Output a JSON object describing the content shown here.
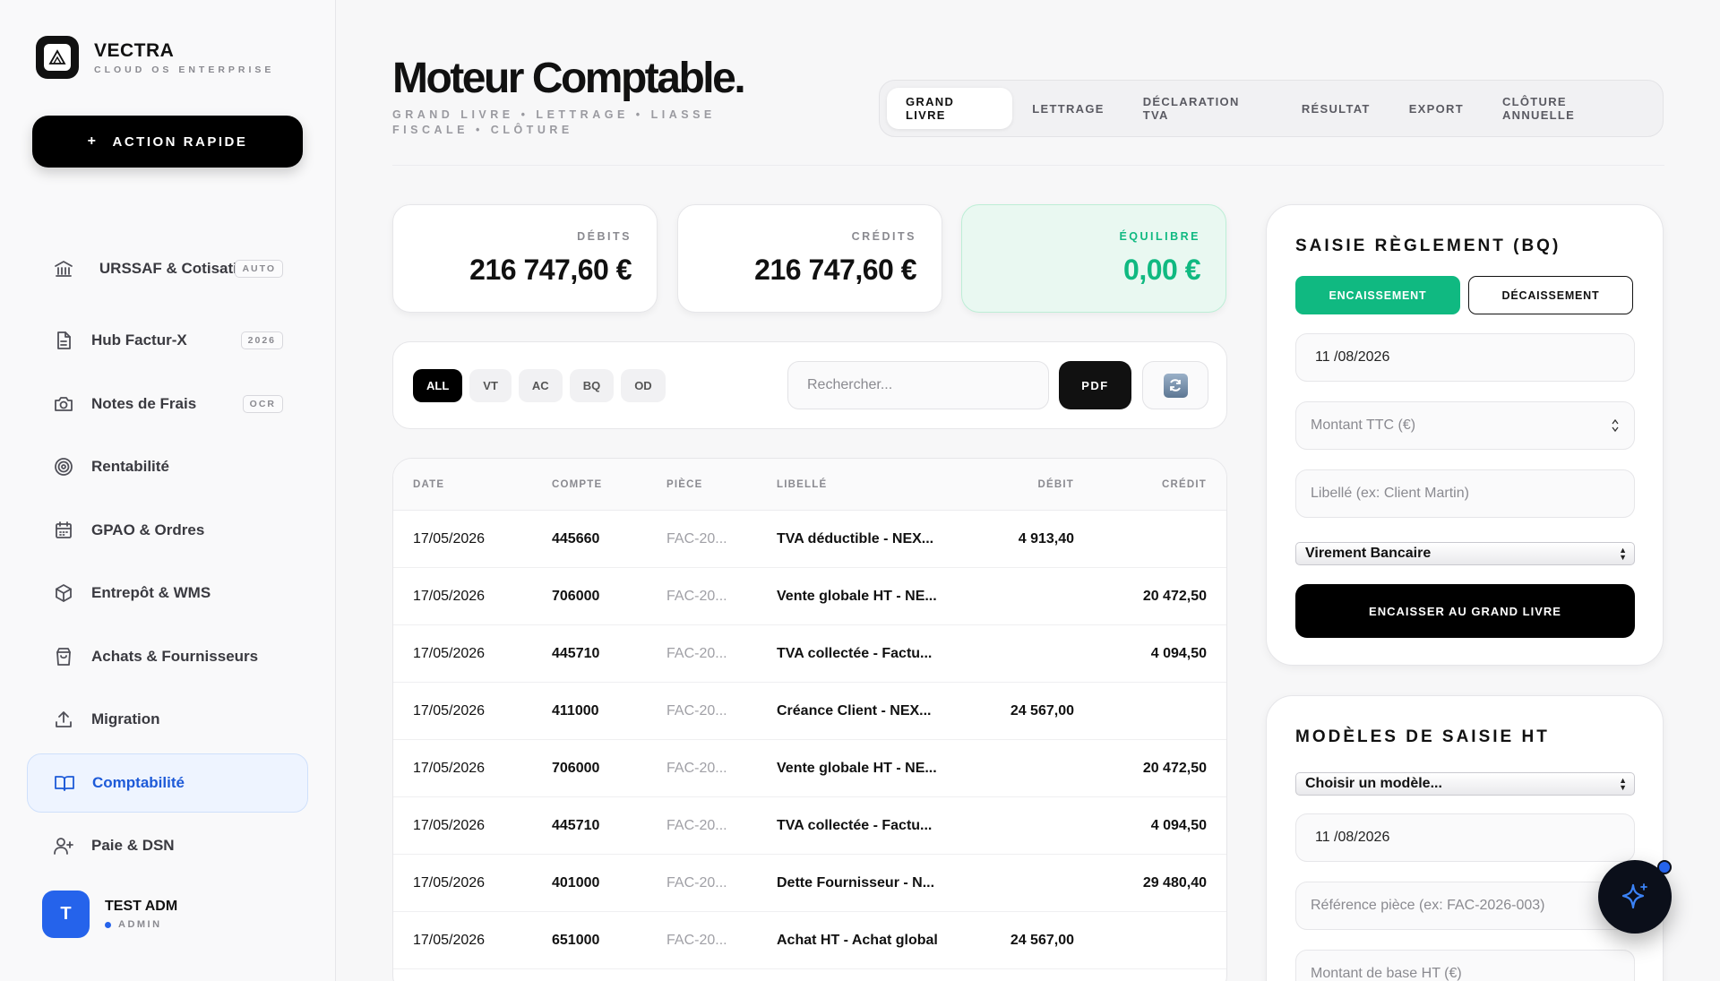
{
  "brand": {
    "name": "VECTRA",
    "subtitle": "CLOUD OS ENTERPRISE"
  },
  "quick_action": {
    "plus": "+",
    "label": "ACTION RAPIDE"
  },
  "sidebar": {
    "items": [
      {
        "label": "URSSAF & Cotisations",
        "icon": "bank-icon",
        "badge": "AUTO"
      },
      {
        "label": "Hub Factur-X",
        "icon": "document-icon",
        "badge": "2026"
      },
      {
        "label": "Notes de Frais",
        "icon": "camera-icon",
        "badge": "OCR"
      },
      {
        "label": "Rentabilité",
        "icon": "target-icon",
        "badge": ""
      },
      {
        "label": "GPAO & Ordres",
        "icon": "calendar-icon",
        "badge": ""
      },
      {
        "label": "Entrepôt & WMS",
        "icon": "box-icon",
        "badge": ""
      },
      {
        "label": "Achats & Fournisseurs",
        "icon": "shopping-bag-icon",
        "badge": ""
      },
      {
        "label": "Migration",
        "icon": "upload-icon",
        "badge": ""
      },
      {
        "label": "Comptabilité",
        "icon": "book-icon",
        "badge": "",
        "active": true
      },
      {
        "label": "Paie & DSN",
        "icon": "user-plus-icon",
        "badge": ""
      }
    ]
  },
  "user": {
    "initial": "T",
    "name": "TEST ADM",
    "role": "ADMIN"
  },
  "header": {
    "title": "Moteur Comptable.",
    "subtitle": "GRAND LIVRE • LETTRAGE • LIASSE FISCALE • CLÔTURE",
    "tabs": [
      "GRAND LIVRE",
      "LETTRAGE",
      "DÉCLARATION TVA",
      "RÉSULTAT",
      "EXPORT",
      "CLÔTURE ANNUELLE"
    ]
  },
  "stats": {
    "debits": {
      "label": "DÉBITS",
      "value": "216 747,60 €"
    },
    "credits": {
      "label": "CRÉDITS",
      "value": "216 747,60 €"
    },
    "balance": {
      "label": "ÉQUILIBRE",
      "value": "0,00 €"
    }
  },
  "filters": {
    "chips": [
      "ALL",
      "VT",
      "AC",
      "BQ",
      "OD"
    ],
    "search_placeholder": "Rechercher...",
    "pdf_label": "PDF"
  },
  "ledger": {
    "headers": {
      "date": "DATE",
      "account": "COMPTE",
      "piece": "PIÈCE",
      "label": "LIBELLÉ",
      "debit": "DÉBIT",
      "credit": "CRÉDIT"
    },
    "rows": [
      {
        "date": "17/05/2026",
        "account": "445660",
        "piece": "FAC-20...",
        "label": "TVA déductible - NEX...",
        "debit": "4 913,40",
        "credit": ""
      },
      {
        "date": "17/05/2026",
        "account": "706000",
        "piece": "FAC-20...",
        "label": "Vente globale HT - NE...",
        "debit": "",
        "credit": "20 472,50"
      },
      {
        "date": "17/05/2026",
        "account": "445710",
        "piece": "FAC-20...",
        "label": "TVA collectée - Factu...",
        "debit": "",
        "credit": "4 094,50"
      },
      {
        "date": "17/05/2026",
        "account": "411000",
        "piece": "FAC-20...",
        "label": "Créance Client - NEX...",
        "debit": "24 567,00",
        "credit": ""
      },
      {
        "date": "17/05/2026",
        "account": "706000",
        "piece": "FAC-20...",
        "label": "Vente globale HT - NE...",
        "debit": "",
        "credit": "20 472,50"
      },
      {
        "date": "17/05/2026",
        "account": "445710",
        "piece": "FAC-20...",
        "label": "TVA collectée - Factu...",
        "debit": "",
        "credit": "4 094,50"
      },
      {
        "date": "17/05/2026",
        "account": "401000",
        "piece": "FAC-20...",
        "label": "Dette Fournisseur - N...",
        "debit": "",
        "credit": "29 480,40"
      },
      {
        "date": "17/05/2026",
        "account": "651000",
        "piece": "FAC-20...",
        "label": "Achat HT - Achat global",
        "debit": "24 567,00",
        "credit": ""
      }
    ]
  },
  "payment_panel": {
    "title": "SAISIE RÈGLEMENT (BQ)",
    "in_label": "ENCAISSEMENT",
    "out_label": "DÉCAISSEMENT",
    "date_value": "11 /08/2026",
    "amount_placeholder": "Montant TTC (€)",
    "label_placeholder": "Libellé (ex: Client Martin)",
    "method_value": "Virement Bancaire",
    "submit_label": "ENCAISSER AU GRAND LIVRE"
  },
  "templates_panel": {
    "title": "MODÈLES DE SAISIE HT",
    "select_value": "Choisir un modèle...",
    "date_value": "11 /08/2026",
    "ref_placeholder": "Référence pièce (ex: FAC-2026-003)",
    "base_placeholder": "Montant de base HT (€)"
  },
  "colors": {
    "accent": "#2563eb",
    "success": "#10b981",
    "dark": "#000000"
  }
}
